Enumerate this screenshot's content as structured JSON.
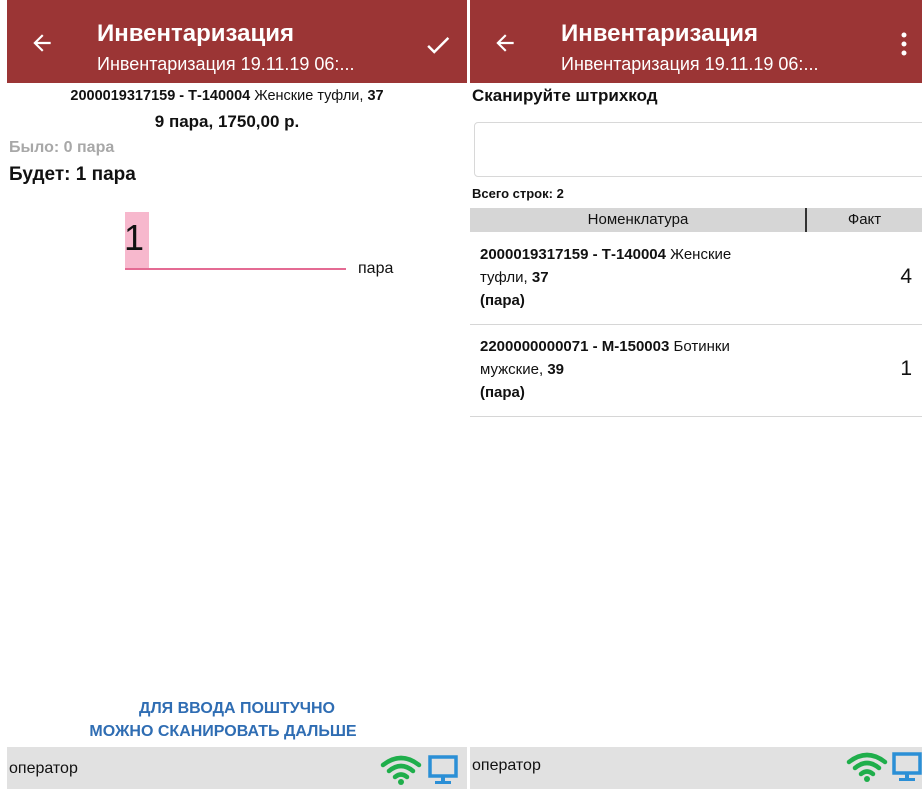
{
  "left_screen": {
    "header": {
      "title": "Инвентаризация",
      "subtitle": "Инвентаризация 19.11.19 06:..."
    },
    "product": {
      "barcode_article": "2000019317159 - Т-140004",
      "name": " Женские туфли, ",
      "size": "37"
    },
    "summary": "9 пара, 1750,00 р.",
    "was": "Было: 0 пара",
    "will_be": "Будет: 1 пара",
    "quantity_input": {
      "value": "1",
      "unit": "пара"
    },
    "hint_line1": "ДЛЯ ВВОДА ПОШТУЧНО",
    "hint_line2": "МОЖНО СКАНИРОВАТЬ ДАЛЬШЕ",
    "status": {
      "user": "оператор"
    }
  },
  "right_screen": {
    "header": {
      "title": "Инвентаризация",
      "subtitle": "Инвентаризация 19.11.19 06:..."
    },
    "scan_label": "Сканируйте штрихкод",
    "scan_input": {
      "value": "",
      "placeholder": ""
    },
    "rows_count": "Всего строк: 2",
    "table": {
      "columns": [
        "Номенклатура",
        "Факт"
      ],
      "rows": [
        {
          "code": "2000019317159 - Т-140004",
          "name_line1": " Женские",
          "name_line2": "туфли, ",
          "size": "37",
          "unit": "(пара)",
          "fact": "4"
        },
        {
          "code": "2200000000071 - М-150003",
          "name_line1": " Ботинки",
          "name_line2": "мужские, ",
          "size": "39",
          "unit": "(пара)",
          "fact": "1"
        }
      ]
    },
    "status": {
      "user": "оператор"
    }
  },
  "colors": {
    "app_bar": "#9b3535",
    "accent_pink": "#e46b93",
    "hint_blue": "#2f6db3",
    "wifi_green": "#1fae4b",
    "monitor_blue": "#2b8fd6"
  },
  "icons": {
    "back": "arrow-left",
    "confirm": "checkmark",
    "menu": "more-vertical",
    "wifi": "wifi",
    "monitor": "monitor"
  }
}
